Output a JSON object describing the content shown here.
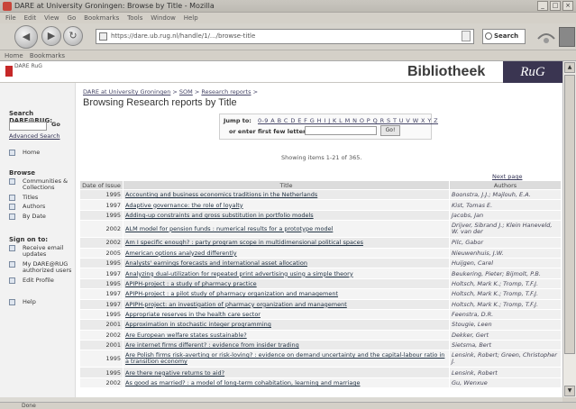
{
  "window": {
    "title": "DARE at University Groningen: Browse by Title - Mozilla",
    "controls": [
      "_",
      "□",
      "×"
    ]
  },
  "menu": [
    "File",
    "Edit",
    "View",
    "Go",
    "Bookmarks",
    "Tools",
    "Window",
    "Help"
  ],
  "toolbar": {
    "url": "https://dare.ub.rug.nl/handle/1/.../browse-title",
    "search_label": "Search"
  },
  "bookmarks": [
    "Home",
    "Bookmarks"
  ],
  "banner": {
    "logo_text": "DARE RuG",
    "bibliotheek": "Bibliotheek",
    "rug": "RuG"
  },
  "sidebar": {
    "search_label": "Search DARE@RUG:",
    "go": "Go",
    "advanced": "Advanced Search",
    "home": "Home",
    "browse_label": "Browse",
    "browse_items": [
      "Communities & Collections",
      "Titles",
      "Authors",
      "By Date"
    ],
    "signon_label": "Sign on to:",
    "signon_items": [
      "Receive email updates",
      "My DARE@RUG authorized users",
      "Edit Profile"
    ],
    "help": "Help"
  },
  "content": {
    "breadcrumb": [
      "DARE at University Groningen",
      "SOM",
      "Research reports"
    ],
    "heading": "Browsing Research reports by Title",
    "jump_label": "Jump to:",
    "letters": "0-9 A B C D E F G H I J K L M N O P Q R S T U V W X Y Z",
    "or_enter": "or enter first few letters:",
    "go_button": "Go!",
    "showing": "Showing items 1-21 of 365.",
    "next_page": "Next page",
    "columns": [
      "Date of Issue",
      "Title",
      "Authors"
    ],
    "rows": [
      {
        "date": "1995",
        "title": "Accounting and business economics traditions in the Netherlands",
        "authors": "Boonstra, J.J.; Majlouh, E.A."
      },
      {
        "date": "1997",
        "title": "Adaptive governance: the role of loyalty",
        "authors": "Kist, Tomas E."
      },
      {
        "date": "1995",
        "title": "Adding-up constraints and gross substitution in portfolio models",
        "authors": "Jacobs, Jan"
      },
      {
        "date": "2002",
        "title": "ALM model for pension funds : numerical results for a prototype model",
        "authors": "Drijver, Sibrand J.; Klein Haneveld, W. van der",
        "tall": true
      },
      {
        "date": "2002",
        "title": "Am I specific enough? : party program scope in multidimensional political spaces",
        "authors": "Pilc, Gabor"
      },
      {
        "date": "2005",
        "title": "American options analyzed differently",
        "authors": "Nieuwenhuis, J.W."
      },
      {
        "date": "1995",
        "title": "Analysts' earnings forecasts and international asset allocation",
        "authors": "Huijgen, Carel"
      },
      {
        "date": "1997",
        "title": "Analyzing dual-utilization for repeated print advertising using a simple theory",
        "authors": "Beukering, Pieter; Bijmolt, P.B."
      },
      {
        "date": "1995",
        "title": "APIPH-project : a study of pharmacy practice",
        "authors": "Holtsch, Mark K.; Tromp, T.F.J."
      },
      {
        "date": "1997",
        "title": "APIPH-project : a pilot study of pharmacy organization and management",
        "authors": "Holtsch, Mark K.; Tromp, T.F.J."
      },
      {
        "date": "1997",
        "title": "APIPH-project: an investigation of pharmacy organization and management",
        "authors": "Holtsch, Mark K.; Tromp, T.F.J."
      },
      {
        "date": "1995",
        "title": "Appropriate reserves in the health care sector",
        "authors": "Feenstra, D.R."
      },
      {
        "date": "2001",
        "title": "Approximation in stochastic integer programming",
        "authors": "Stougie, Leen"
      },
      {
        "date": "2002",
        "title": "Are European welfare states sustainable?",
        "authors": "Dekker, Gert"
      },
      {
        "date": "2001",
        "title": "Are internet firms different? : evidence from insider trading",
        "authors": "Sietsma, Bert"
      },
      {
        "date": "1995",
        "title": "Are Polish firms risk-averting or risk-loving? : evidence on demand uncertainty and the capital-labour ratio in a transition economy",
        "authors": "Lensink, Robert; Green, Christopher J.",
        "tall": true
      },
      {
        "date": "1995",
        "title": "Are there negative returns to aid?",
        "authors": "Lensink, Robert"
      },
      {
        "date": "2002",
        "title": "As good as married? : a model of long-term cohabitation, learning and marriage",
        "authors": "Gu, Wenxue"
      }
    ]
  },
  "statusbar": "Done"
}
